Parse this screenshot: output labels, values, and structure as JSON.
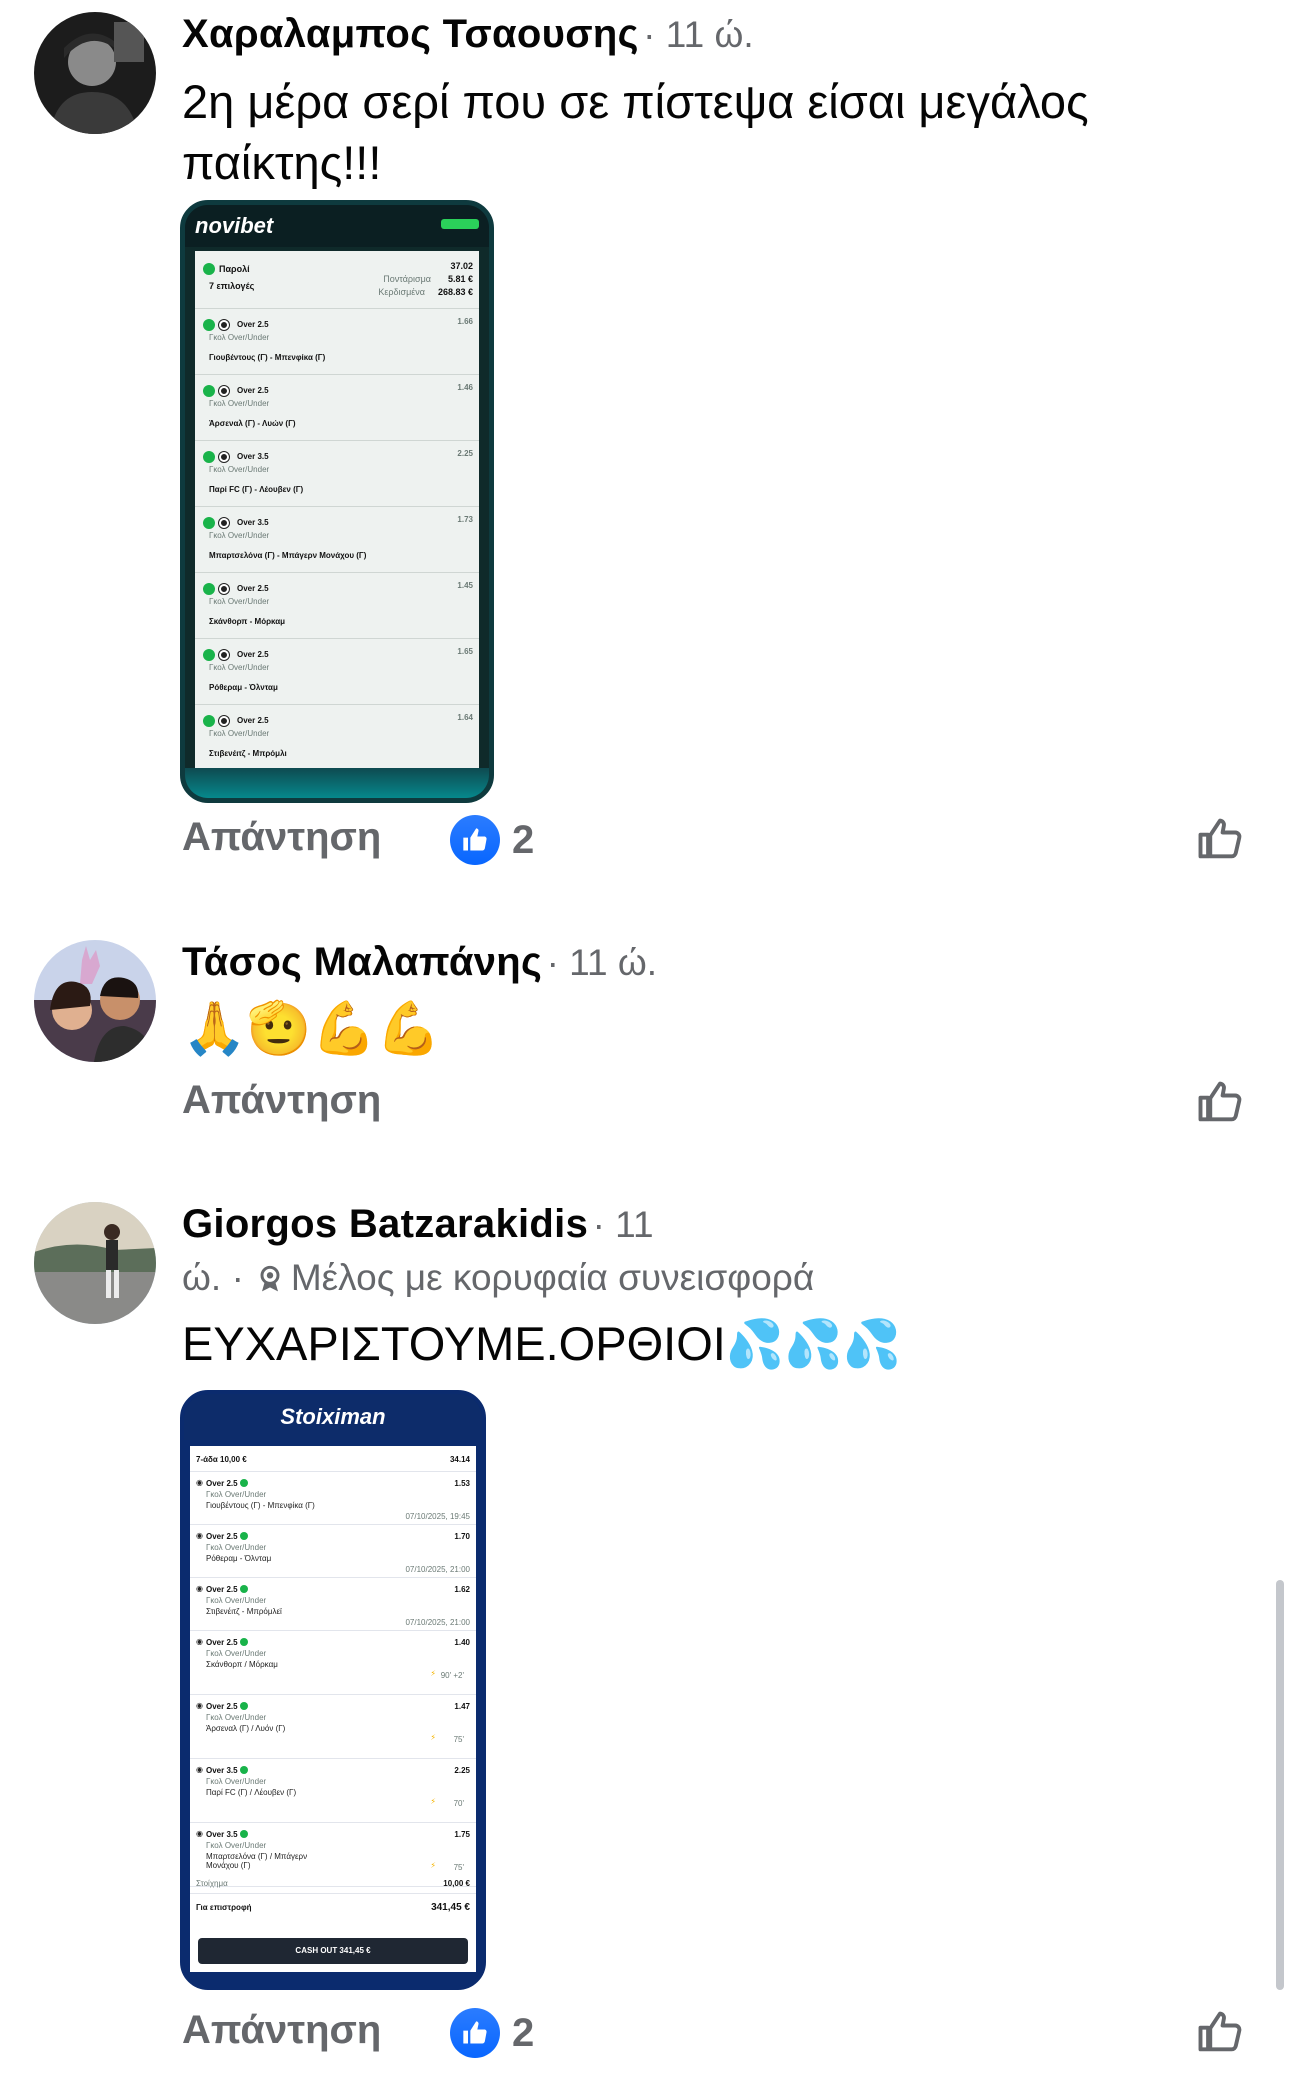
{
  "comments": [
    {
      "author": "Χαραλαμπος Τσαουσης",
      "time": "· 11 ώ.",
      "text": "2η μέρα σερί που σε πίστεψα είσαι μεγάλος παίκτης!!!",
      "reply_label": "Απάντηση",
      "reaction_count": "2",
      "attachment": {
        "brand": "novibet",
        "header_row": {
          "label": "Παρολί",
          "sub": "7 επιλογές",
          "odds": "37.02",
          "stake_label": "Ποντάρισμα",
          "stake": "5.81 €",
          "win_label": "Κερδισμένα",
          "win": "268.83 €"
        },
        "bets": [
          {
            "pick": "Over 2.5",
            "market": "Γκολ Over/Under",
            "match": "Γιουβέντους (Γ) - Μπενφίκα (Γ)",
            "odds": "1.66"
          },
          {
            "pick": "Over 2.5",
            "market": "Γκολ Over/Under",
            "match": "Άρσεναλ (Γ) - Λυών (Γ)",
            "odds": "1.46"
          },
          {
            "pick": "Over 3.5",
            "market": "Γκολ Over/Under",
            "match": "Παρί FC (Γ) - Λέουβεν (Γ)",
            "odds": "2.25"
          },
          {
            "pick": "Over 3.5",
            "market": "Γκολ Over/Under",
            "match": "Μπαρτσελόνα (Γ) - Μπάγερν Μονάχου (Γ)",
            "odds": "1.73"
          },
          {
            "pick": "Over 2.5",
            "market": "Γκολ Over/Under",
            "match": "Σκάνθορπ - Μόρκαμ",
            "odds": "1.45"
          },
          {
            "pick": "Over 2.5",
            "market": "Γκολ Over/Under",
            "match": "Ρόθεραμ - Όλνταμ",
            "odds": "1.65"
          },
          {
            "pick": "Over 2.5",
            "market": "Γκολ Over/Under",
            "match": "Στιβενέιτζ - Μπρόμλι",
            "odds": "1.64"
          }
        ]
      }
    },
    {
      "author": "Τάσος Μαλαπάνης",
      "time": "· 11 ώ.",
      "text": "🙏🫡💪💪",
      "reply_label": "Απάντηση"
    },
    {
      "author": "Giorgos Batzarakidis",
      "time": "· 11",
      "time_cont": "ώ.",
      "badge_sep": "·",
      "badge": "Μέλος με κορυφαία συνεισφορά",
      "text": "ΕΥΧΑΡΙΣΤΟΥΜΕ.ΟΡΘΙΟΙ💦💦💦",
      "reply_label": "Απάντηση",
      "reaction_count": "2",
      "attachment": {
        "brand": "Stoiximan",
        "header_label": "7-άδα 10,00 €",
        "header_odds": "34.14",
        "bets": [
          {
            "pick": "Over 2.5",
            "market": "Γκολ Over/Under",
            "match": "Γιουβέντους (Γ) - Μπενφίκα (Γ)",
            "date": "07/10/2025, 19:45",
            "odds": "1.53"
          },
          {
            "pick": "Over 2.5",
            "market": "Γκολ Over/Under",
            "match": "Ρόθεραμ - Όλνταμ",
            "date": "07/10/2025, 21:00",
            "odds": "1.70"
          },
          {
            "pick": "Over 2.5",
            "market": "Γκολ Over/Under",
            "match": "Στιβενέιτζ - Μπρόμλεϊ",
            "date": "07/10/2025, 21:00",
            "odds": "1.62"
          },
          {
            "pick": "Over 2.5",
            "market": "Γκολ Over/Under",
            "match": "Σκάνθορπ / Μόρκαμ",
            "live": "90' +2'",
            "odds": "1.40"
          },
          {
            "pick": "Over 2.5",
            "market": "Γκολ Over/Under",
            "match": "Άρσεναλ (Γ) / Λυόν (Γ)",
            "live": "75'",
            "odds": "1.47"
          },
          {
            "pick": "Over 3.5",
            "market": "Γκολ Over/Under",
            "match": "Παρί FC (Γ) / Λέουβεν (Γ)",
            "live": "70'",
            "odds": "2.25"
          },
          {
            "pick": "Over 3.5",
            "market": "Γκολ Over/Under",
            "match": "Μπαρτσελόνα (Γ) / Μπάγερν Μονάχου (Γ)",
            "live": "75'",
            "odds": "1.75"
          }
        ],
        "stake_label": "Στοίχημα",
        "stake": "10,00 €",
        "return_label": "Για επιστροφή",
        "return_value": "341,45 €",
        "cashout": "CASH OUT  341,45 €"
      }
    }
  ],
  "colors": {
    "like_blue": "#0866ff",
    "secondary_text": "#65676b",
    "success_green": "#19b34a"
  }
}
